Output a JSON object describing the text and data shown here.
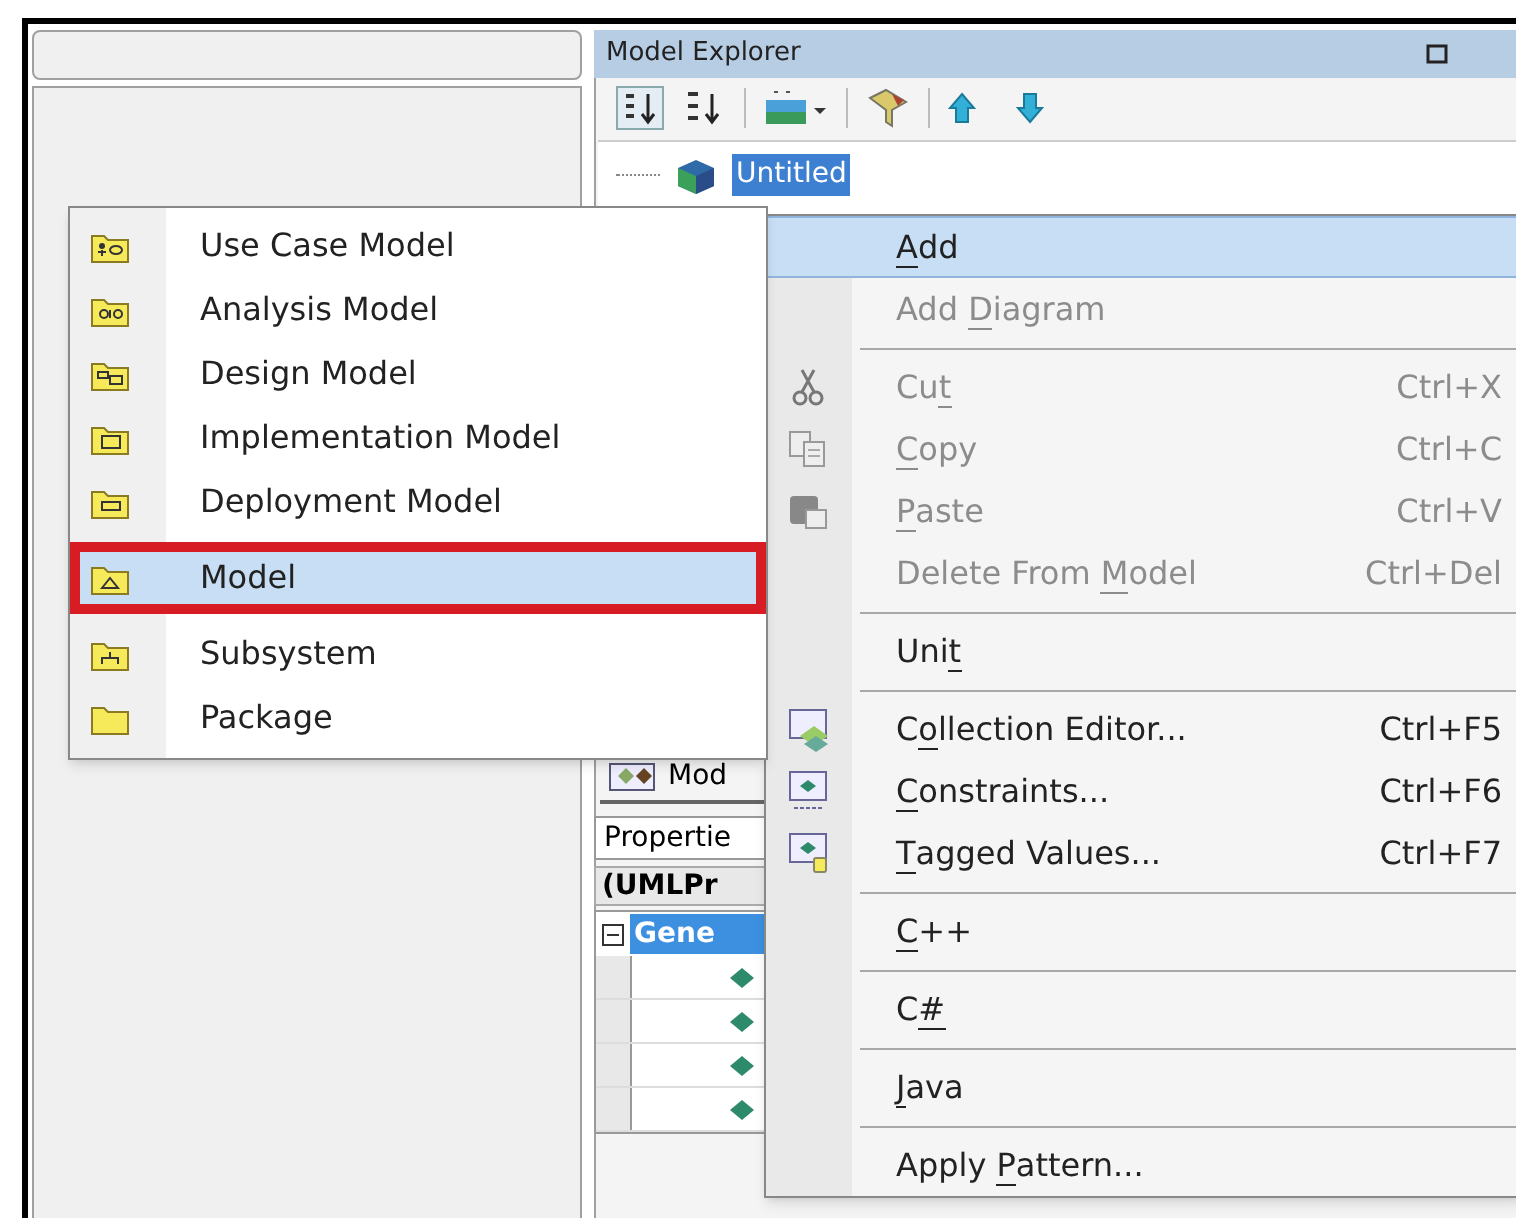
{
  "model_explorer": {
    "title": "Model Explorer",
    "tree": [
      {
        "label": "Untitled",
        "selected": true
      }
    ]
  },
  "bottom_tab": {
    "label": "Mod"
  },
  "properties_selector": {
    "value": "Propertie"
  },
  "element_type": "(UMLPr",
  "property_grid": {
    "category": {
      "label": "Gene",
      "expanded": true
    },
    "rows": [
      {
        "kind": "property"
      },
      {
        "kind": "property"
      },
      {
        "kind": "property"
      },
      {
        "kind": "property"
      }
    ]
  },
  "submenu": {
    "items": [
      {
        "label": "Use Case Model",
        "selected": false,
        "outlined": false
      },
      {
        "label": "Analysis Model",
        "selected": false,
        "outlined": false
      },
      {
        "label": "Design Model",
        "selected": false,
        "outlined": false
      },
      {
        "label": "Implementation Model",
        "selected": false,
        "outlined": false
      },
      {
        "label": "Deployment Model",
        "selected": false,
        "outlined": false
      },
      {
        "label": "Model",
        "selected": true,
        "outlined": true
      },
      {
        "label": "Subsystem",
        "selected": false,
        "outlined": false
      },
      {
        "label": "Package",
        "selected": false,
        "outlined": false
      }
    ]
  },
  "context_menu": {
    "items": [
      {
        "kind": "item",
        "label": [
          {
            "text": "A",
            "underlined": true
          },
          {
            "text": "dd",
            "underlined": false
          }
        ],
        "disabled": false,
        "selected": true
      },
      {
        "kind": "item",
        "label": [
          {
            "text": "Add ",
            "underlined": false
          },
          {
            "text": "D",
            "underlined": true
          },
          {
            "text": "iagram",
            "underlined": false
          }
        ],
        "disabled": true,
        "selected": false
      },
      {
        "kind": "separator"
      },
      {
        "kind": "item",
        "label": [
          {
            "text": "Cu",
            "underlined": false
          },
          {
            "text": "t",
            "underlined": true
          }
        ],
        "shortcut": "Ctrl+X",
        "disabled": true,
        "selected": false
      },
      {
        "kind": "item",
        "label": [
          {
            "text": "C",
            "underlined": true
          },
          {
            "text": "opy",
            "underlined": false
          }
        ],
        "shortcut": "Ctrl+C",
        "disabled": true,
        "selected": false
      },
      {
        "kind": "item",
        "label": [
          {
            "text": "P",
            "underlined": true
          },
          {
            "text": "aste",
            "underlined": false
          }
        ],
        "shortcut": "Ctrl+V",
        "disabled": true,
        "selected": false
      },
      {
        "kind": "item",
        "label": [
          {
            "text": "Delete From ",
            "underlined": false
          },
          {
            "text": "M",
            "underlined": true
          },
          {
            "text": "odel",
            "underlined": false
          }
        ],
        "shortcut": "Ctrl+Del",
        "disabled": true,
        "selected": false
      },
      {
        "kind": "separator"
      },
      {
        "kind": "item",
        "label": [
          {
            "text": "Uni",
            "underlined": false
          },
          {
            "text": "t",
            "underlined": true
          }
        ],
        "disabled": false,
        "selected": false
      },
      {
        "kind": "separator"
      },
      {
        "kind": "item",
        "label": [
          {
            "text": "C",
            "underlined": false
          },
          {
            "text": "o",
            "underlined": true
          },
          {
            "text": "llection Editor...",
            "underlined": false
          }
        ],
        "shortcut": "Ctrl+F5",
        "disabled": false,
        "selected": false
      },
      {
        "kind": "item",
        "label": [
          {
            "text": "C",
            "underlined": true
          },
          {
            "text": "onstraints...",
            "underlined": false
          }
        ],
        "shortcut": "Ctrl+F6",
        "disabled": false,
        "selected": false
      },
      {
        "kind": "item",
        "label": [
          {
            "text": "T",
            "underlined": true
          },
          {
            "text": "agged Values...",
            "underlined": false
          }
        ],
        "shortcut": "Ctrl+F7",
        "disabled": false,
        "selected": false
      },
      {
        "kind": "separator"
      },
      {
        "kind": "item",
        "label": [
          {
            "text": "C",
            "underlined": true
          },
          {
            "text": "++",
            "underlined": false
          }
        ],
        "disabled": false,
        "selected": false
      },
      {
        "kind": "separator"
      },
      {
        "kind": "item",
        "label": [
          {
            "text": "C",
            "underlined": false
          },
          {
            "text": "#",
            "underlined": true
          }
        ],
        "disabled": false,
        "selected": false
      },
      {
        "kind": "separator"
      },
      {
        "kind": "item",
        "label": [
          {
            "text": "J",
            "underlined": true
          },
          {
            "text": "ava",
            "underlined": false
          }
        ],
        "disabled": false,
        "selected": false
      },
      {
        "kind": "separator"
      },
      {
        "kind": "item",
        "label": [
          {
            "text": "Apply ",
            "underlined": false
          },
          {
            "text": "P",
            "underlined": true
          },
          {
            "text": "attern...",
            "underlined": false
          }
        ],
        "disabled": false,
        "selected": false
      }
    ]
  }
}
